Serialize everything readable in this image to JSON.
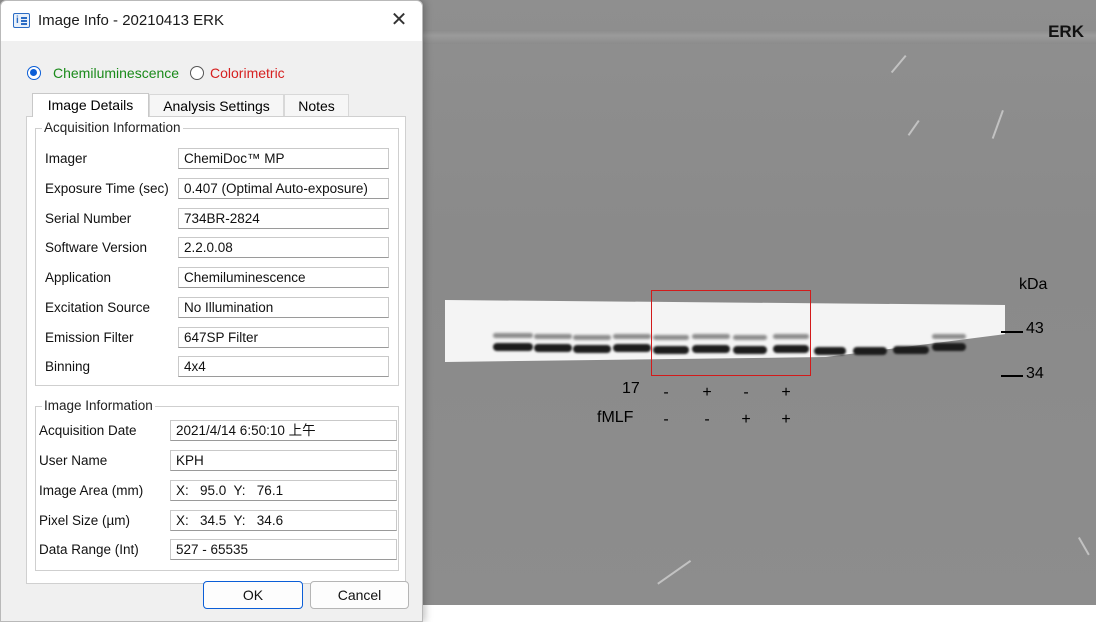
{
  "window": {
    "title": "Image Info - 20210413 ERK",
    "close_glyph": "✕"
  },
  "mode": {
    "chemi_label": "Chemiluminescence",
    "color_label": "Colorimetric",
    "selected": "Chemiluminescence",
    "chemi_color": "#1a8a1a",
    "color_color": "#d62020"
  },
  "tabs": [
    {
      "label": "Image Details",
      "active": true
    },
    {
      "label": "Analysis Settings"
    },
    {
      "label": "Notes"
    }
  ],
  "acquisition": {
    "title": "Acquisition Information",
    "rows": [
      {
        "label": "Imager",
        "value": "ChemiDoc™ MP"
      },
      {
        "label": "Exposure Time (sec)",
        "value": "0.407 (Optimal Auto-exposure)"
      },
      {
        "label": "Serial Number",
        "value": "734BR-2824"
      },
      {
        "label": "Software Version",
        "value": "2.2.0.08"
      },
      {
        "label": "Application",
        "value": "Chemiluminescence"
      },
      {
        "label": "Excitation Source",
        "value": "No Illumination"
      },
      {
        "label": "Emission Filter",
        "value": "647SP Filter"
      },
      {
        "label": "Binning",
        "value": "4x4"
      }
    ]
  },
  "image_info": {
    "title": "Image Information",
    "rows": [
      {
        "label": "Acquisition Date",
        "value": "2021/4/14 6:50:10 上午"
      },
      {
        "label": "User Name",
        "value": "KPH"
      },
      {
        "label": "Image Area (mm)",
        "value": "X:   95.0  Y:   76.1"
      },
      {
        "label": "Pixel Size (µm)",
        "value": "X:   34.5  Y:   34.6"
      },
      {
        "label": "Data Range (Int)",
        "value": "527 - 65535"
      }
    ]
  },
  "buttons": {
    "ok": "OK",
    "cancel": "Cancel"
  },
  "blot": {
    "title": "ERK",
    "unit": "kDa",
    "markers": [
      "43",
      "34"
    ],
    "row_labels": [
      "17",
      "fMLF"
    ],
    "row1_signs": [
      "-",
      "+",
      "-",
      "+"
    ],
    "row2_signs": [
      "-",
      "-",
      "+",
      "+"
    ],
    "roi_color": "#d21a1a"
  },
  "icons": {
    "window_icon": "info-icon",
    "close_icon": "close-icon"
  }
}
